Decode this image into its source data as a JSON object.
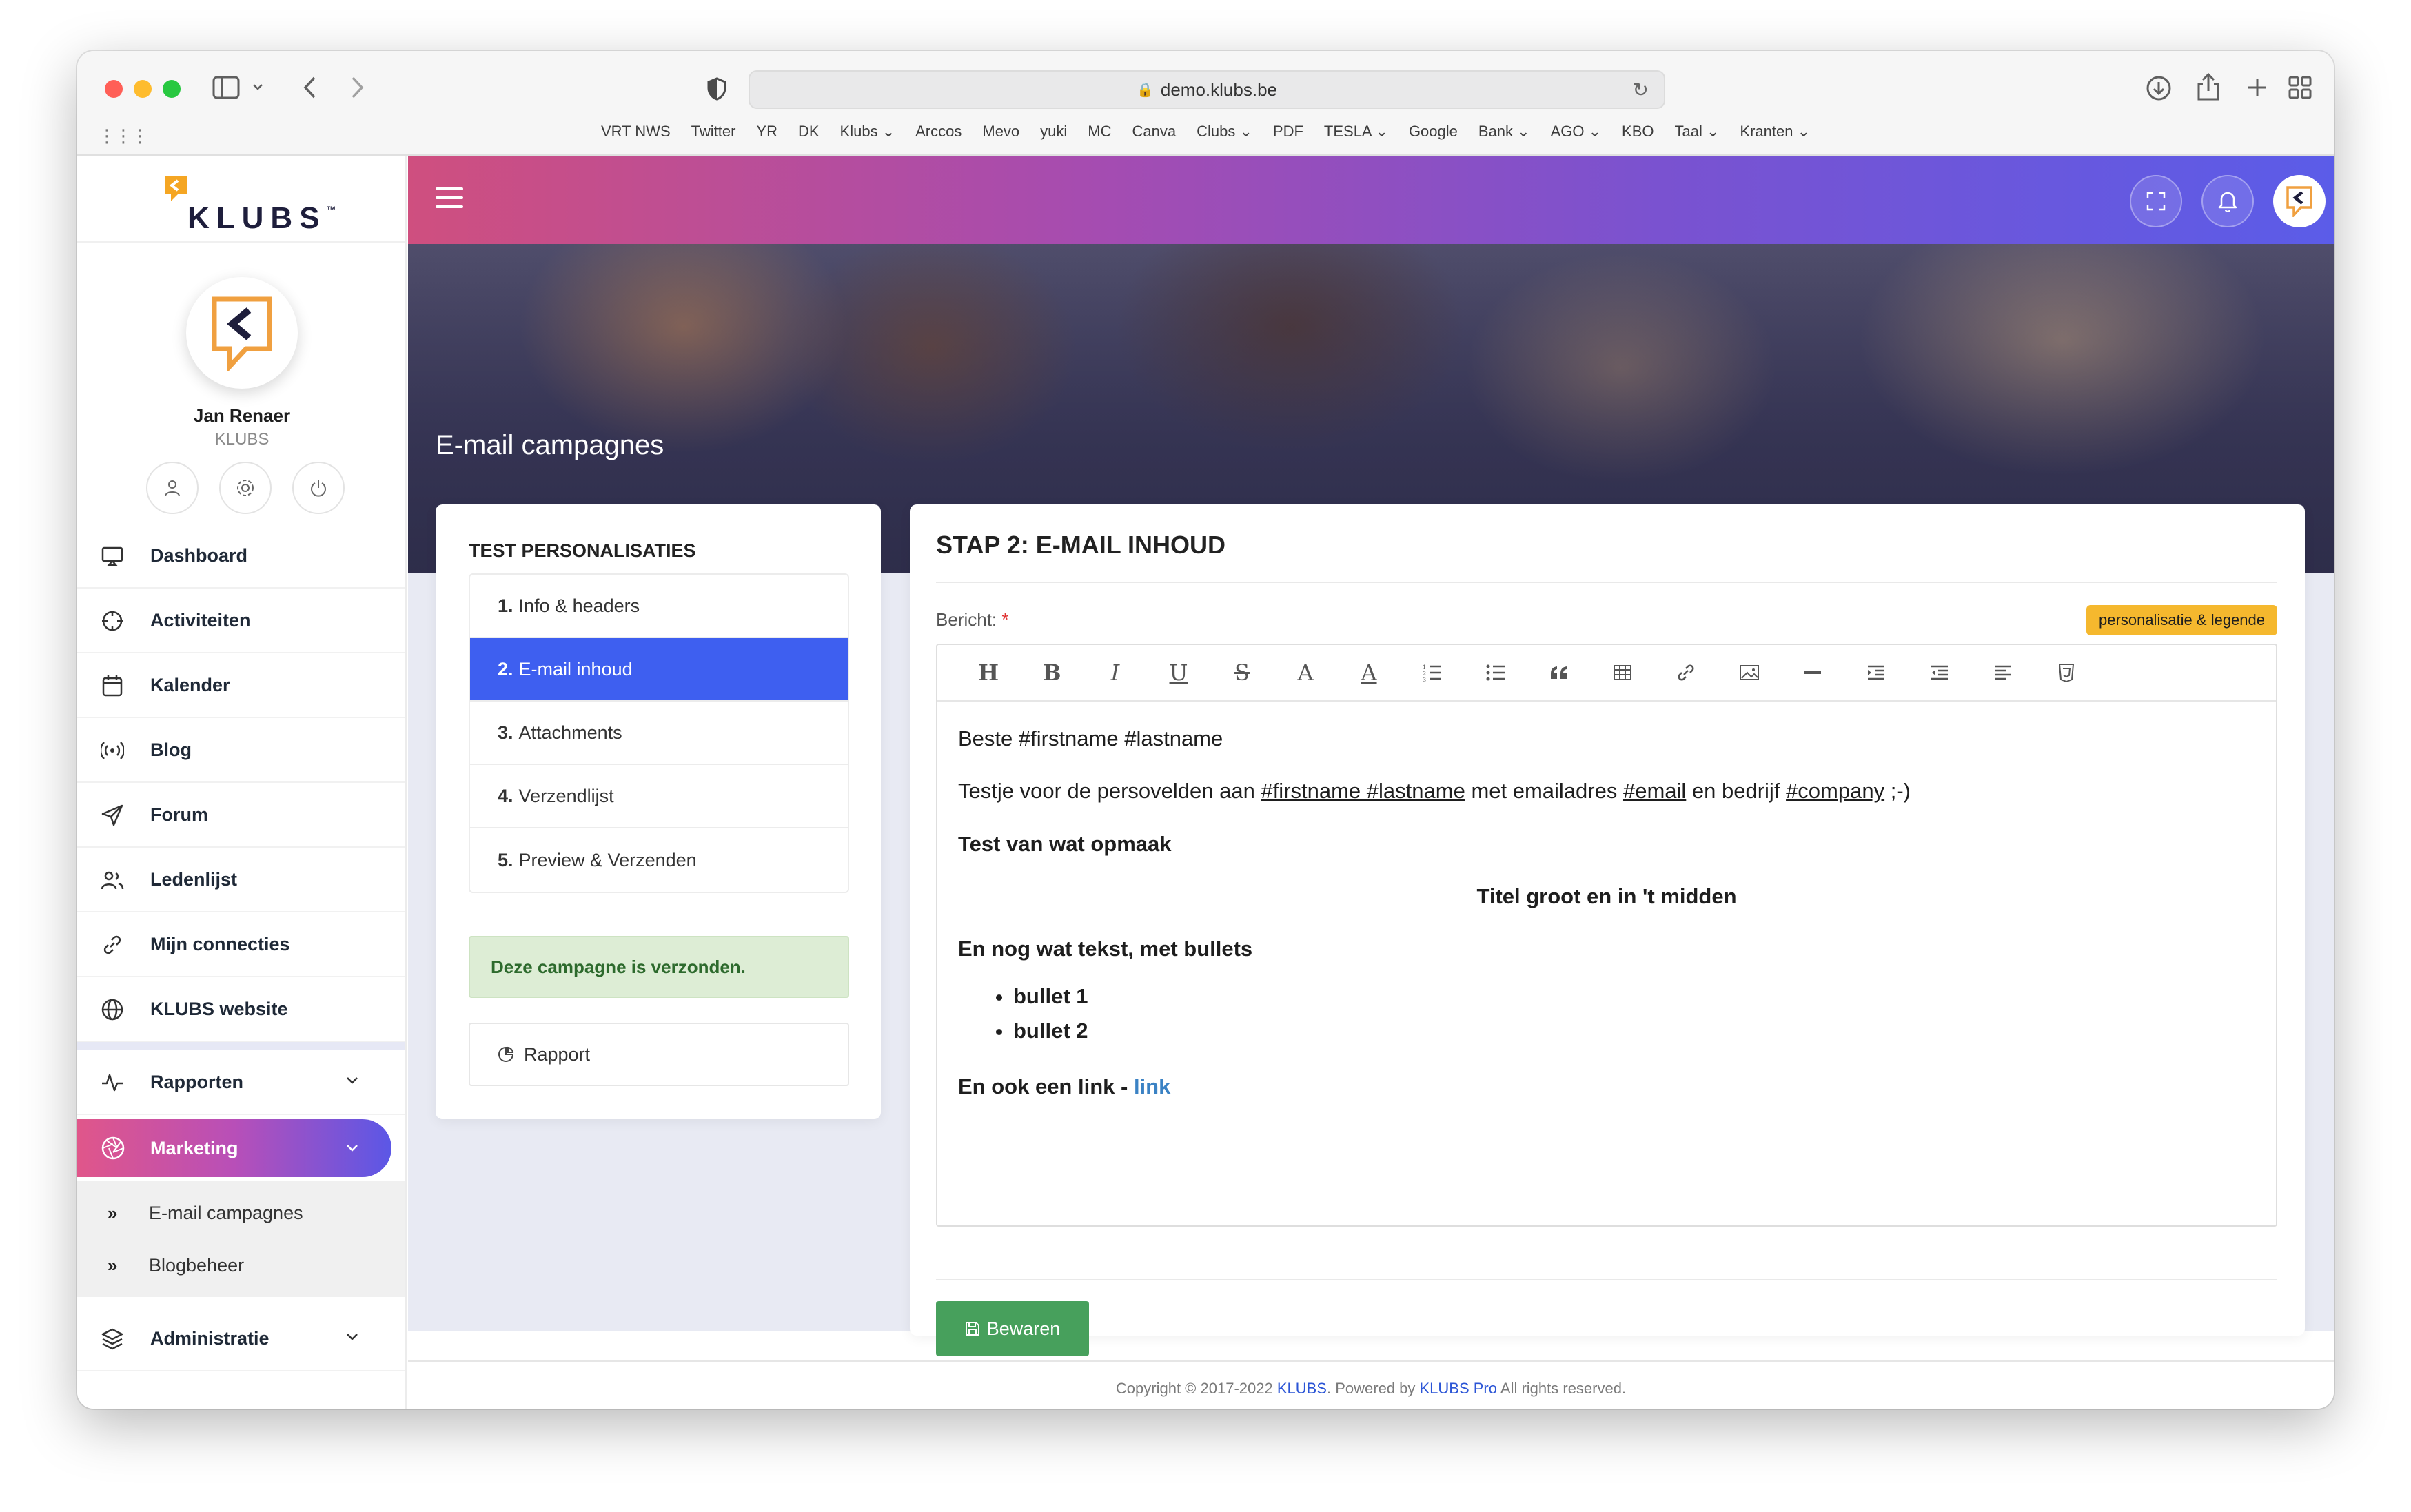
{
  "browser": {
    "url": "demo.klubs.be",
    "favorites": [
      "VRT NWS",
      "Twitter",
      "YR",
      "DK",
      "Klubs ⌄",
      "Arccos",
      "Mevo",
      "yuki",
      "MC",
      "Canva",
      "Clubs ⌄",
      "PDF",
      "TESLA ⌄",
      "Google",
      "Bank ⌄",
      "AGO ⌄",
      "KBO",
      "Taal ⌄",
      "Kranten ⌄"
    ]
  },
  "sidebar": {
    "logo_text": "KLUBS",
    "logo_tm": "™",
    "profile": {
      "name": "Jan Renaer",
      "org": "KLUBS"
    },
    "items": [
      {
        "label": "Dashboard",
        "icon": "monitor-icon"
      },
      {
        "label": "Activiteiten",
        "icon": "crosshair-icon"
      },
      {
        "label": "Kalender",
        "icon": "calendar-icon"
      },
      {
        "label": "Blog",
        "icon": "broadcast-icon"
      },
      {
        "label": "Forum",
        "icon": "send-icon"
      },
      {
        "label": "Ledenlijst",
        "icon": "users-icon"
      },
      {
        "label": "Mijn connecties",
        "icon": "link-icon"
      },
      {
        "label": "KLUBS website",
        "icon": "globe-icon"
      }
    ],
    "rapporten": "Rapporten",
    "marketing": "Marketing",
    "sub_items": [
      "E-mail campagnes",
      "Blogbeheer"
    ],
    "administratie": "Administratie"
  },
  "hero": {
    "title": "E-mail campagnes"
  },
  "left_card": {
    "title": "TEST PERSONALISATIES",
    "steps": [
      {
        "num": "1.",
        "label": "Info & headers"
      },
      {
        "num": "2.",
        "label": "E-mail inhoud"
      },
      {
        "num": "3.",
        "label": "Attachments"
      },
      {
        "num": "4.",
        "label": "Verzendlijst"
      },
      {
        "num": "5.",
        "label": "Preview & Verzenden"
      }
    ],
    "active_step": 2,
    "alert": "Deze campagne is verzonden.",
    "rapport": "Rapport"
  },
  "right_card": {
    "title": "STAP 2: E-MAIL INHOUD",
    "field_label": "Bericht:",
    "required_mark": "*",
    "badge": "personalisatie & legende",
    "toolbar": [
      "H",
      "B",
      "I",
      "U",
      "S",
      "A",
      "A"
    ],
    "content": {
      "greeting": "Beste #firstname #lastname",
      "line2_a": "Testje voor de persovelden aan ",
      "line2_u1": "#firstname #lastname",
      "line2_b": " met emailadres ",
      "line2_u2": "#email",
      "line2_c": " en bedrijf ",
      "line2_u3": "#company",
      "line2_d": " ;-)",
      "bold_line": "Test van wat opmaak",
      "centered_title": "Titel groot en in 't midden",
      "bullets_intro": "En nog wat tekst, met bullets",
      "bullets": [
        "bullet 1",
        "bullet 2"
      ],
      "link_intro": "En ook een link - ",
      "link_text": "link"
    },
    "save": "Bewaren"
  },
  "footer": {
    "prefix": "Copyright © 2017-2022 ",
    "brand": "KLUBS",
    "middle": ". Powered by ",
    "powered": "KLUBS Pro",
    "suffix": " All rights reserved."
  }
}
